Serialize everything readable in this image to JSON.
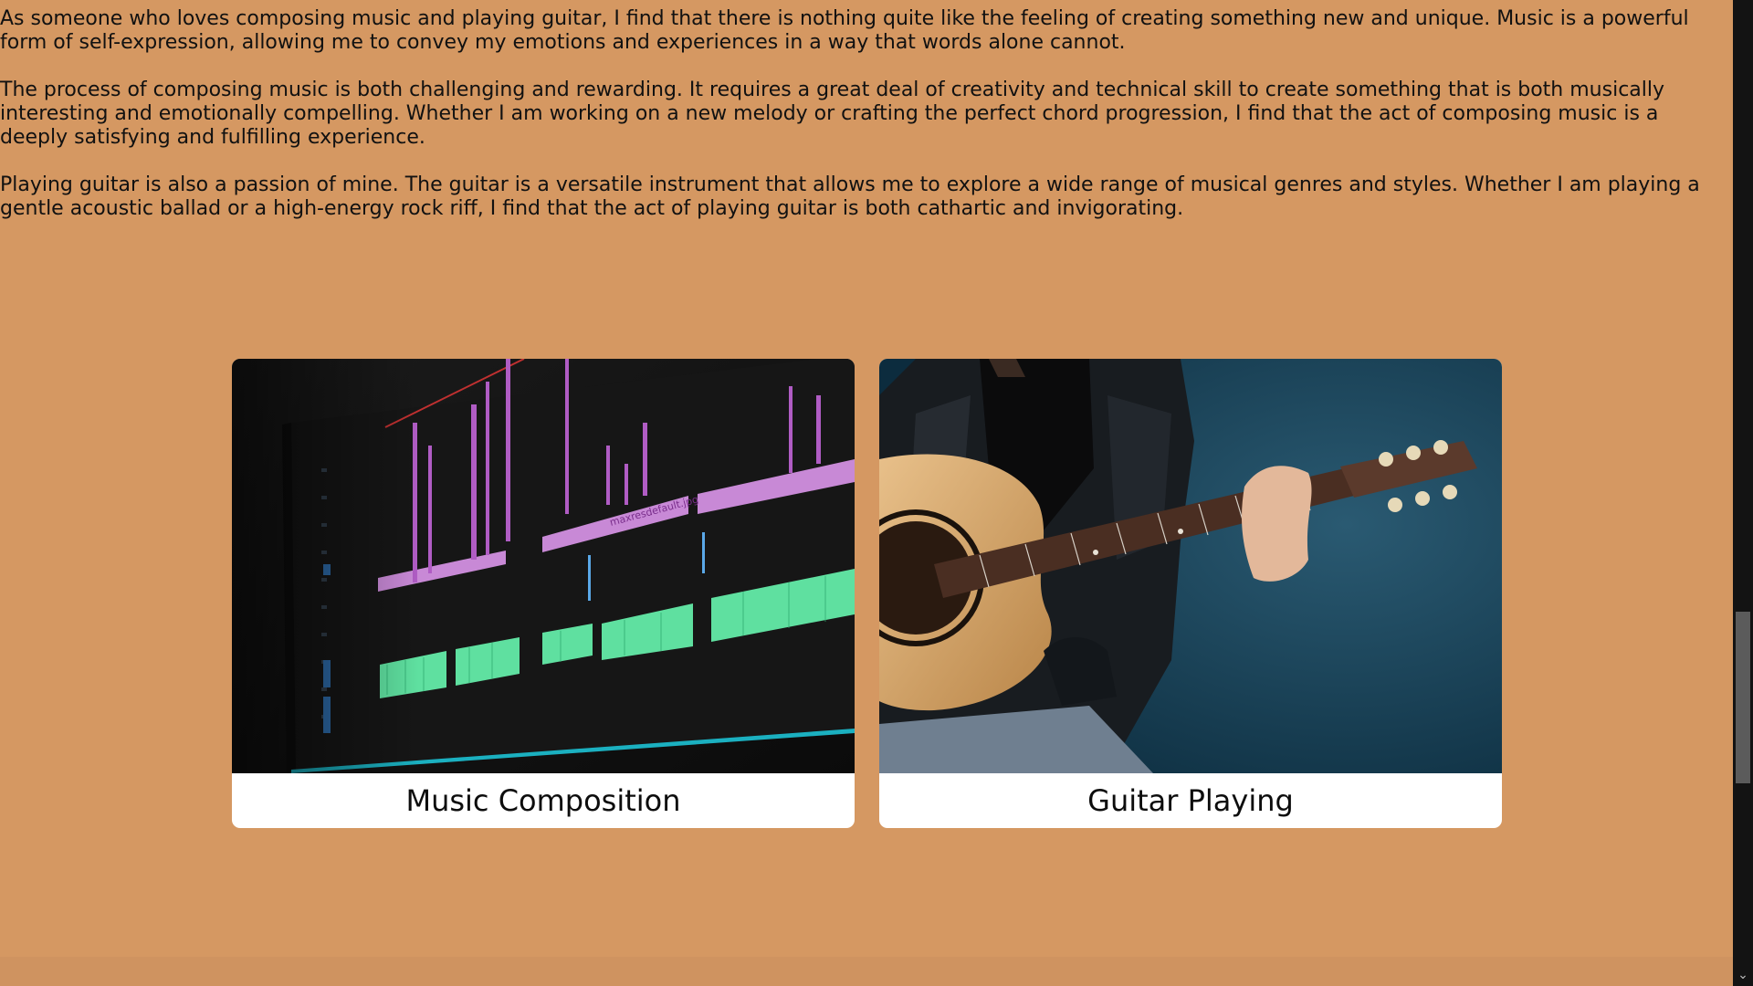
{
  "article": {
    "paragraphs": [
      "As someone who loves composing music and playing guitar, I find that there is nothing quite like the feeling of creating something new and unique. Music is a powerful form of self-expression, allowing me to convey my emotions and experiences in a way that words alone cannot.",
      "The process of composing music is both challenging and rewarding. It requires a great deal of creativity and technical skill to create something that is both musically interesting and emotionally compelling. Whether I am working on a new melody or crafting the perfect chord progression, I find that the act of composing music is a deeply satisfying and fulfilling experience.",
      "Playing guitar is also a passion of mine. The guitar is a versatile instrument that allows me to explore a wide range of musical genres and styles. Whether I am playing a gentle acoustic ballad or a high-energy rock riff, I find that the act of playing guitar is both cathartic and invigorating."
    ]
  },
  "cards": [
    {
      "title": "Music Composition",
      "image_label": "maxresdefault.jpg",
      "icon": "audio-editor-image"
    },
    {
      "title": "Guitar Playing",
      "icon": "guitarist-image"
    }
  ],
  "scrollbar": {
    "down_arrow": "⌄"
  },
  "colors": {
    "page_background": "#d59862",
    "card_background": "#ffffff",
    "text": "#111111",
    "scrollbar_track": "#131313",
    "scrollbar_thumb": "#5b5b5b"
  }
}
